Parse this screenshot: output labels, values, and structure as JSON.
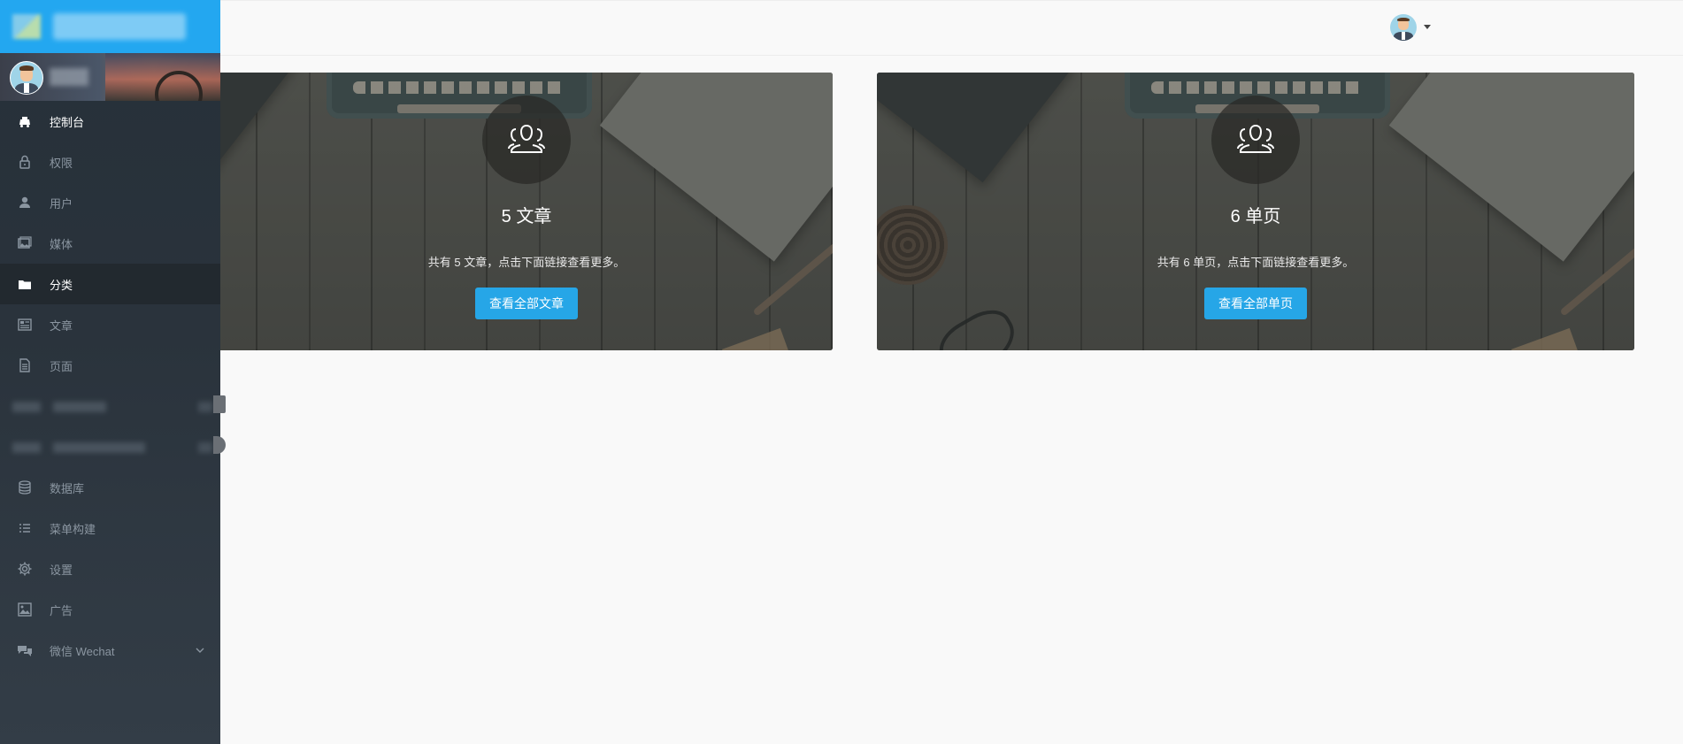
{
  "sidebar": {
    "menu": [
      {
        "label": "控制台",
        "icon": "dashboard-icon"
      },
      {
        "label": "权限",
        "icon": "lock-icon"
      },
      {
        "label": "用户",
        "icon": "user-icon"
      },
      {
        "label": "媒体",
        "icon": "media-icon"
      },
      {
        "label": "分类",
        "icon": "folder-icon"
      },
      {
        "label": "文章",
        "icon": "article-icon"
      },
      {
        "label": "页面",
        "icon": "page-icon"
      },
      {
        "label": "数据库",
        "icon": "database-icon"
      },
      {
        "label": "菜单构建",
        "icon": "list-icon"
      },
      {
        "label": "设置",
        "icon": "gear-icon"
      },
      {
        "label": "广告",
        "icon": "image-icon"
      },
      {
        "label": "微信 Wechat",
        "icon": "wechat-icon"
      }
    ]
  },
  "cards": [
    {
      "icon": "users-icon",
      "count": "5",
      "unit": "文章",
      "description": "共有 5 文章，点击下面链接查看更多。",
      "button_label": "查看全部文章"
    },
    {
      "icon": "users-icon",
      "count": "6",
      "unit": "单页",
      "description": "共有 6 单页，点击下面链接查看更多。",
      "button_label": "查看全部单页"
    }
  ],
  "colors": {
    "brand": "#23a7f0",
    "button": "#26a6e7",
    "sidebar_bg": "#2a333c",
    "menu_text": "#8b96a1"
  }
}
